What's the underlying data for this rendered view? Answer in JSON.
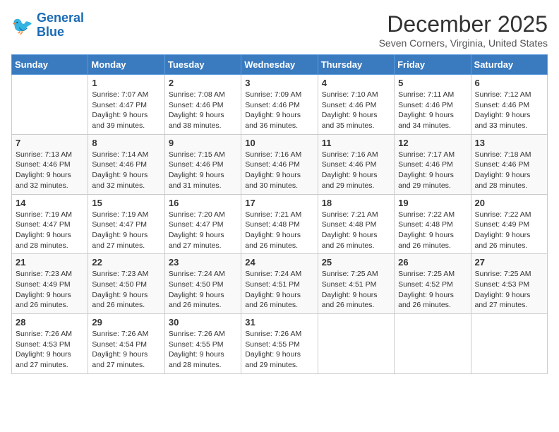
{
  "logo": {
    "line1": "General",
    "line2": "Blue"
  },
  "title": "December 2025",
  "location": "Seven Corners, Virginia, United States",
  "days_header": [
    "Sunday",
    "Monday",
    "Tuesday",
    "Wednesday",
    "Thursday",
    "Friday",
    "Saturday"
  ],
  "weeks": [
    [
      {
        "day": "",
        "info": ""
      },
      {
        "day": "1",
        "info": "Sunrise: 7:07 AM\nSunset: 4:47 PM\nDaylight: 9 hours\nand 39 minutes."
      },
      {
        "day": "2",
        "info": "Sunrise: 7:08 AM\nSunset: 4:46 PM\nDaylight: 9 hours\nand 38 minutes."
      },
      {
        "day": "3",
        "info": "Sunrise: 7:09 AM\nSunset: 4:46 PM\nDaylight: 9 hours\nand 36 minutes."
      },
      {
        "day": "4",
        "info": "Sunrise: 7:10 AM\nSunset: 4:46 PM\nDaylight: 9 hours\nand 35 minutes."
      },
      {
        "day": "5",
        "info": "Sunrise: 7:11 AM\nSunset: 4:46 PM\nDaylight: 9 hours\nand 34 minutes."
      },
      {
        "day": "6",
        "info": "Sunrise: 7:12 AM\nSunset: 4:46 PM\nDaylight: 9 hours\nand 33 minutes."
      }
    ],
    [
      {
        "day": "7",
        "info": "Sunrise: 7:13 AM\nSunset: 4:46 PM\nDaylight: 9 hours\nand 32 minutes."
      },
      {
        "day": "8",
        "info": "Sunrise: 7:14 AM\nSunset: 4:46 PM\nDaylight: 9 hours\nand 32 minutes."
      },
      {
        "day": "9",
        "info": "Sunrise: 7:15 AM\nSunset: 4:46 PM\nDaylight: 9 hours\nand 31 minutes."
      },
      {
        "day": "10",
        "info": "Sunrise: 7:16 AM\nSunset: 4:46 PM\nDaylight: 9 hours\nand 30 minutes."
      },
      {
        "day": "11",
        "info": "Sunrise: 7:16 AM\nSunset: 4:46 PM\nDaylight: 9 hours\nand 29 minutes."
      },
      {
        "day": "12",
        "info": "Sunrise: 7:17 AM\nSunset: 4:46 PM\nDaylight: 9 hours\nand 29 minutes."
      },
      {
        "day": "13",
        "info": "Sunrise: 7:18 AM\nSunset: 4:46 PM\nDaylight: 9 hours\nand 28 minutes."
      }
    ],
    [
      {
        "day": "14",
        "info": "Sunrise: 7:19 AM\nSunset: 4:47 PM\nDaylight: 9 hours\nand 28 minutes."
      },
      {
        "day": "15",
        "info": "Sunrise: 7:19 AM\nSunset: 4:47 PM\nDaylight: 9 hours\nand 27 minutes."
      },
      {
        "day": "16",
        "info": "Sunrise: 7:20 AM\nSunset: 4:47 PM\nDaylight: 9 hours\nand 27 minutes."
      },
      {
        "day": "17",
        "info": "Sunrise: 7:21 AM\nSunset: 4:48 PM\nDaylight: 9 hours\nand 26 minutes."
      },
      {
        "day": "18",
        "info": "Sunrise: 7:21 AM\nSunset: 4:48 PM\nDaylight: 9 hours\nand 26 minutes."
      },
      {
        "day": "19",
        "info": "Sunrise: 7:22 AM\nSunset: 4:48 PM\nDaylight: 9 hours\nand 26 minutes."
      },
      {
        "day": "20",
        "info": "Sunrise: 7:22 AM\nSunset: 4:49 PM\nDaylight: 9 hours\nand 26 minutes."
      }
    ],
    [
      {
        "day": "21",
        "info": "Sunrise: 7:23 AM\nSunset: 4:49 PM\nDaylight: 9 hours\nand 26 minutes."
      },
      {
        "day": "22",
        "info": "Sunrise: 7:23 AM\nSunset: 4:50 PM\nDaylight: 9 hours\nand 26 minutes."
      },
      {
        "day": "23",
        "info": "Sunrise: 7:24 AM\nSunset: 4:50 PM\nDaylight: 9 hours\nand 26 minutes."
      },
      {
        "day": "24",
        "info": "Sunrise: 7:24 AM\nSunset: 4:51 PM\nDaylight: 9 hours\nand 26 minutes."
      },
      {
        "day": "25",
        "info": "Sunrise: 7:25 AM\nSunset: 4:51 PM\nDaylight: 9 hours\nand 26 minutes."
      },
      {
        "day": "26",
        "info": "Sunrise: 7:25 AM\nSunset: 4:52 PM\nDaylight: 9 hours\nand 26 minutes."
      },
      {
        "day": "27",
        "info": "Sunrise: 7:25 AM\nSunset: 4:53 PM\nDaylight: 9 hours\nand 27 minutes."
      }
    ],
    [
      {
        "day": "28",
        "info": "Sunrise: 7:26 AM\nSunset: 4:53 PM\nDaylight: 9 hours\nand 27 minutes."
      },
      {
        "day": "29",
        "info": "Sunrise: 7:26 AM\nSunset: 4:54 PM\nDaylight: 9 hours\nand 27 minutes."
      },
      {
        "day": "30",
        "info": "Sunrise: 7:26 AM\nSunset: 4:55 PM\nDaylight: 9 hours\nand 28 minutes."
      },
      {
        "day": "31",
        "info": "Sunrise: 7:26 AM\nSunset: 4:55 PM\nDaylight: 9 hours\nand 29 minutes."
      },
      {
        "day": "",
        "info": ""
      },
      {
        "day": "",
        "info": ""
      },
      {
        "day": "",
        "info": ""
      }
    ]
  ]
}
